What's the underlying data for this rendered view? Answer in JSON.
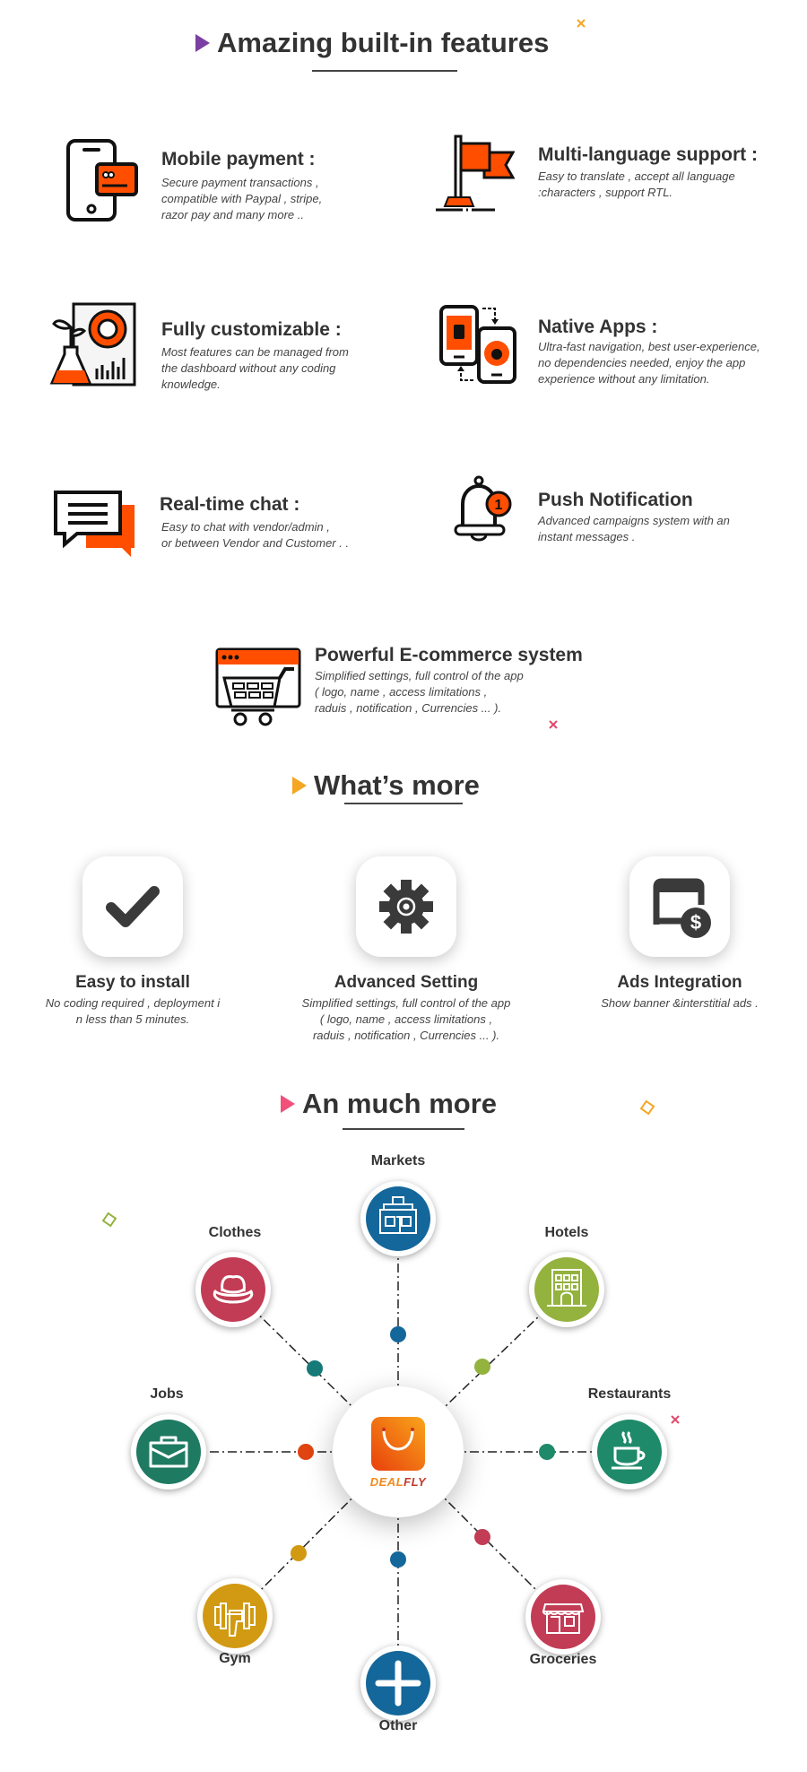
{
  "sections": {
    "features": {
      "title": "Amazing built-in features",
      "marker_color": "#7b3fa3"
    },
    "whats_more": {
      "title": "What’s more",
      "marker_color": "#f5a623"
    },
    "much_more": {
      "title": "An much more",
      "marker_color": "#f0507a"
    }
  },
  "features": [
    {
      "icon": "mobile-payment-icon",
      "title": "Mobile payment :",
      "desc": "Secure payment transactions ,\ncompatible with Paypal , stripe,\nrazor pay and many more .."
    },
    {
      "icon": "flag-icon",
      "title": "Multi-language support :",
      "desc": "Easy to translate , accept all language\n :characters , support RTL."
    },
    {
      "icon": "customize-icon",
      "title": "Fully customizable :",
      "desc": "Most features can be managed from\nthe dashboard without any coding\nknowledge."
    },
    {
      "icon": "native-apps-icon",
      "title": "Native Apps :",
      "desc": "Ultra-fast navigation, best user-experience,\nno dependencies needed, enjoy the app\nexperience without any limitation."
    },
    {
      "icon": "chat-icon",
      "title": "Real-time chat :",
      "desc": "Easy to chat with vendor/admin ,\nor between Vendor and Customer . ."
    },
    {
      "icon": "bell-icon",
      "title": "Push Notification",
      "desc": "Advanced campaigns system with an\ninstant messages .",
      "badge": "1"
    },
    {
      "icon": "ecommerce-cart-icon",
      "title": "Powerful E-commerce system",
      "desc": "Simplified settings, full control of the app\n ( logo, name , access limitations ,\nraduis , notification , Currencies ... )."
    }
  ],
  "whats_more": [
    {
      "icon": "checkmark-icon",
      "title": "Easy to install",
      "desc": "No coding required , deployment i\nn less than 5 minutes."
    },
    {
      "icon": "gear-icon",
      "title": "Advanced Setting",
      "desc": "Simplified settings, full control of the app\n( logo, name , access limitations ,\nraduis , notification , Currencies ... )."
    },
    {
      "icon": "ads-dollar-icon",
      "title": "Ads Integration",
      "desc": "Show banner &interstitial ads ."
    }
  ],
  "hub": {
    "brand_part1": "DEAL",
    "brand_part2": "FLY",
    "color1": "#f08a1c",
    "color2": "#c0392b"
  },
  "categories": [
    {
      "label": "Markets",
      "color": "#14679a",
      "icon": "market-store-icon",
      "dot_color": "#14679a"
    },
    {
      "label": "Hotels",
      "color": "#94b23e",
      "icon": "hotel-building-icon",
      "dot_color": "#94b23e"
    },
    {
      "label": "Restaurants",
      "color": "#1f8a6a",
      "icon": "coffee-cup-icon",
      "dot_color": "#1f8a6a"
    },
    {
      "label": "Groceries",
      "color": "#c23c55",
      "icon": "grocery-shop-icon",
      "dot_color": "#c23c55"
    },
    {
      "label": "Other",
      "color": "#14679a",
      "icon": "plus-icon",
      "dot_color": "#14679a"
    },
    {
      "label": "Gym",
      "color": "#d19a12",
      "icon": "dumbbell-icon",
      "dot_color": "#d19a12"
    },
    {
      "label": "Jobs",
      "color": "#1f7a62",
      "icon": "briefcase-icon",
      "dot_color": "#e04410"
    },
    {
      "label": "Clothes",
      "color": "#c23c55",
      "icon": "hat-icon",
      "dot_color": "#157a78"
    }
  ],
  "colors": {
    "accent_orange": "#ff4e00",
    "dark": "#333333"
  }
}
